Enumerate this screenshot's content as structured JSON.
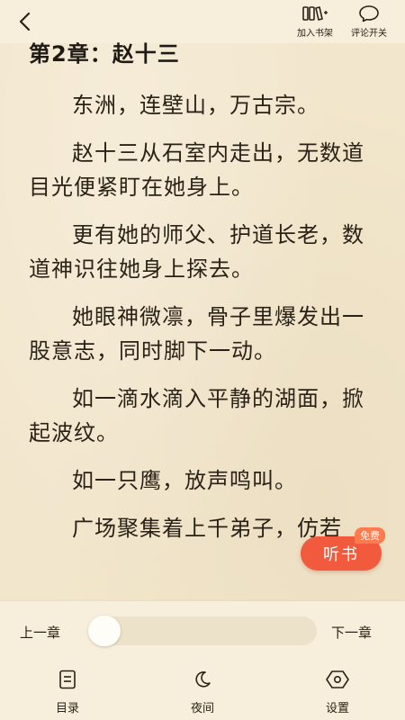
{
  "topbar": {
    "back_icon": "chevron-left-icon",
    "add_shelf_label": "加入书架",
    "comment_toggle_label": "评论开关"
  },
  "chapter": {
    "title": "第2章：赵十三",
    "paragraphs": [
      "东洲，连壁山，万古宗。",
      "赵十三从石室内走出，无数道目光便紧盯在她身上。",
      "更有她的师父、护道长老，数道神识往她身上探去。",
      "她眼神微凛，骨子里爆发出一股意志，同时脚下一动。",
      "如一滴水滴入平静的湖面，掀起波纹。",
      "如一只鹰，放声鸣叫。",
      "广场聚集着上千弟子，仿若"
    ]
  },
  "listen": {
    "label": "听书",
    "badge": "免费"
  },
  "bottom": {
    "prev_label": "上一章",
    "next_label": "下一章",
    "progress_fraction": 0.0,
    "toc_label": "目录",
    "night_label": "夜间",
    "settings_label": "设置"
  },
  "colors": {
    "background": "#f2e6cc",
    "panel": "#f7eedc",
    "listen_button": "#f25a3e",
    "text": "#2b2217"
  }
}
